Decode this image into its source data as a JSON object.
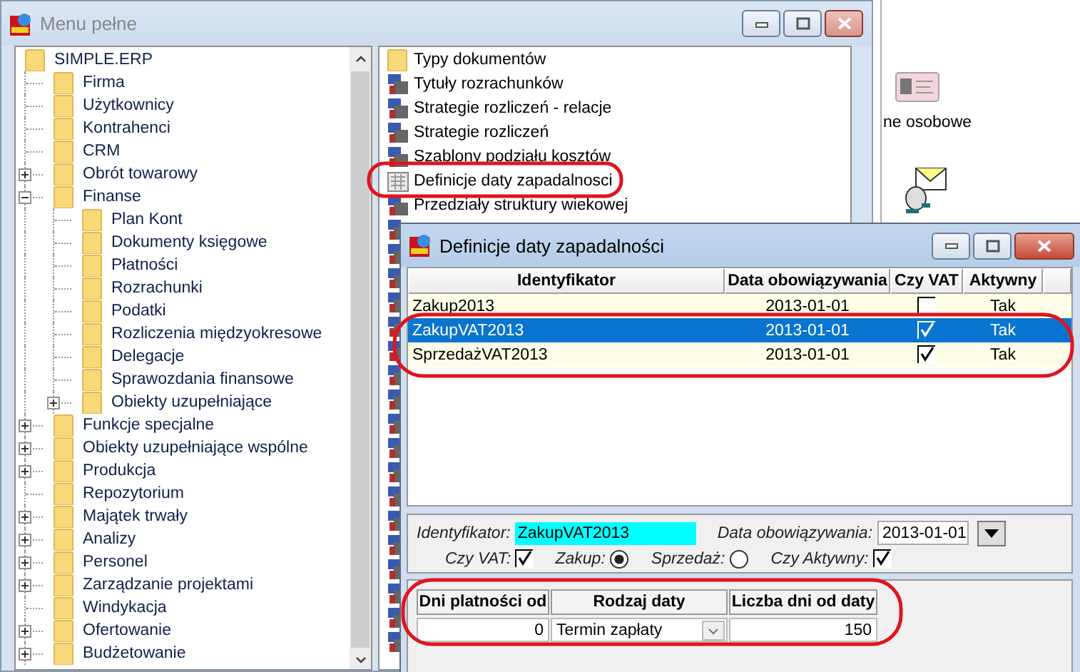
{
  "menu_window": {
    "title": "Menu pełne",
    "tree": [
      {
        "label": "SIMPLE.ERP",
        "children": [
          {
            "label": "Firma"
          },
          {
            "label": "Użytkownicy"
          },
          {
            "label": "Kontrahenci"
          },
          {
            "label": "CRM"
          },
          {
            "label": "Obrót towarowy",
            "expanded": false
          },
          {
            "label": "Finanse",
            "expanded": true,
            "children": [
              {
                "label": "Plan Kont"
              },
              {
                "label": "Dokumenty księgowe"
              },
              {
                "label": "Płatności"
              },
              {
                "label": "Rozrachunki"
              },
              {
                "label": "Podatki"
              },
              {
                "label": "Rozliczenia międzyokresowe"
              },
              {
                "label": "Delegacje"
              },
              {
                "label": "Sprawozdania finansowe"
              },
              {
                "label": "Obiekty uzupełniające",
                "expanded": false
              }
            ]
          },
          {
            "label": "Funkcje specjalne",
            "expanded": false
          },
          {
            "label": "Obiekty uzupełniające wspólne",
            "expanded": false
          },
          {
            "label": "Produkcja",
            "expanded": false
          },
          {
            "label": "Repozytorium"
          },
          {
            "label": "Majątek trwały",
            "expanded": false
          },
          {
            "label": "Analizy",
            "expanded": false
          },
          {
            "label": "Personel",
            "expanded": false
          },
          {
            "label": "Zarządzanie projektami",
            "expanded": false
          },
          {
            "label": "Windykacja"
          },
          {
            "label": "Ofertowanie",
            "expanded": false
          },
          {
            "label": "Budżetowanie",
            "expanded": false
          }
        ]
      }
    ],
    "items": [
      {
        "label": "Typy dokumentów",
        "kind": "folder"
      },
      {
        "label": "Tytuły rozrachunków",
        "kind": "module"
      },
      {
        "label": "Strategie rozliczeń - relacje",
        "kind": "module"
      },
      {
        "label": "Strategie rozliczeń",
        "kind": "module"
      },
      {
        "label": "Szablony podziału kosztów",
        "kind": "module"
      },
      {
        "label": "Definicje daty zapadalnosci",
        "kind": "calendar"
      },
      {
        "label": "Przedziały struktury wiekowej",
        "kind": "module"
      },
      {
        "kind": "module"
      },
      {
        "kind": "module"
      },
      {
        "kind": "module"
      },
      {
        "kind": "module"
      },
      {
        "kind": "module"
      },
      {
        "kind": "module"
      },
      {
        "kind": "module"
      },
      {
        "kind": "module"
      },
      {
        "kind": "module"
      },
      {
        "kind": "module"
      },
      {
        "kind": "module"
      },
      {
        "kind": "module"
      },
      {
        "kind": "module"
      },
      {
        "kind": "module"
      },
      {
        "kind": "module"
      },
      {
        "kind": "module"
      },
      {
        "kind": "module"
      },
      {
        "kind": "module"
      }
    ],
    "side_label": "ne osobowe"
  },
  "dialog": {
    "title": "Definicje daty zapadalności",
    "columns": [
      "Identyfikator",
      "Data obowiązywania",
      "Czy VAT",
      "Aktywny"
    ],
    "rows": [
      {
        "id": "Zakup2013",
        "date": "2013-01-01",
        "vat": false,
        "active": "Tak",
        "selected": false
      },
      {
        "id": "ZakupVAT2013",
        "date": "2013-01-01",
        "vat": true,
        "active": "Tak",
        "selected": true
      },
      {
        "id": "SprzedażVAT2013",
        "date": "2013-01-01",
        "vat": true,
        "active": "Tak",
        "selected": false
      }
    ],
    "form": {
      "id_label": "Identyfikator:",
      "id_value": "ZakupVAT2013",
      "date_label": "Data obowiązywania:",
      "date_value": "2013-01-01",
      "vat_label": "Czy VAT:",
      "vat_checked": true,
      "radios": [
        {
          "label": "Zakup:",
          "selected": true
        },
        {
          "label": "Sprzedaż:",
          "selected": false
        }
      ],
      "active_label": "Czy Aktywny:",
      "active_checked": true
    },
    "terms": {
      "columns": [
        "Dni platności od",
        "Rodzaj daty",
        "Liczba dni od daty"
      ],
      "rows": [
        {
          "from": "0",
          "type": "Termin zapłaty",
          "days": "150"
        }
      ]
    }
  }
}
